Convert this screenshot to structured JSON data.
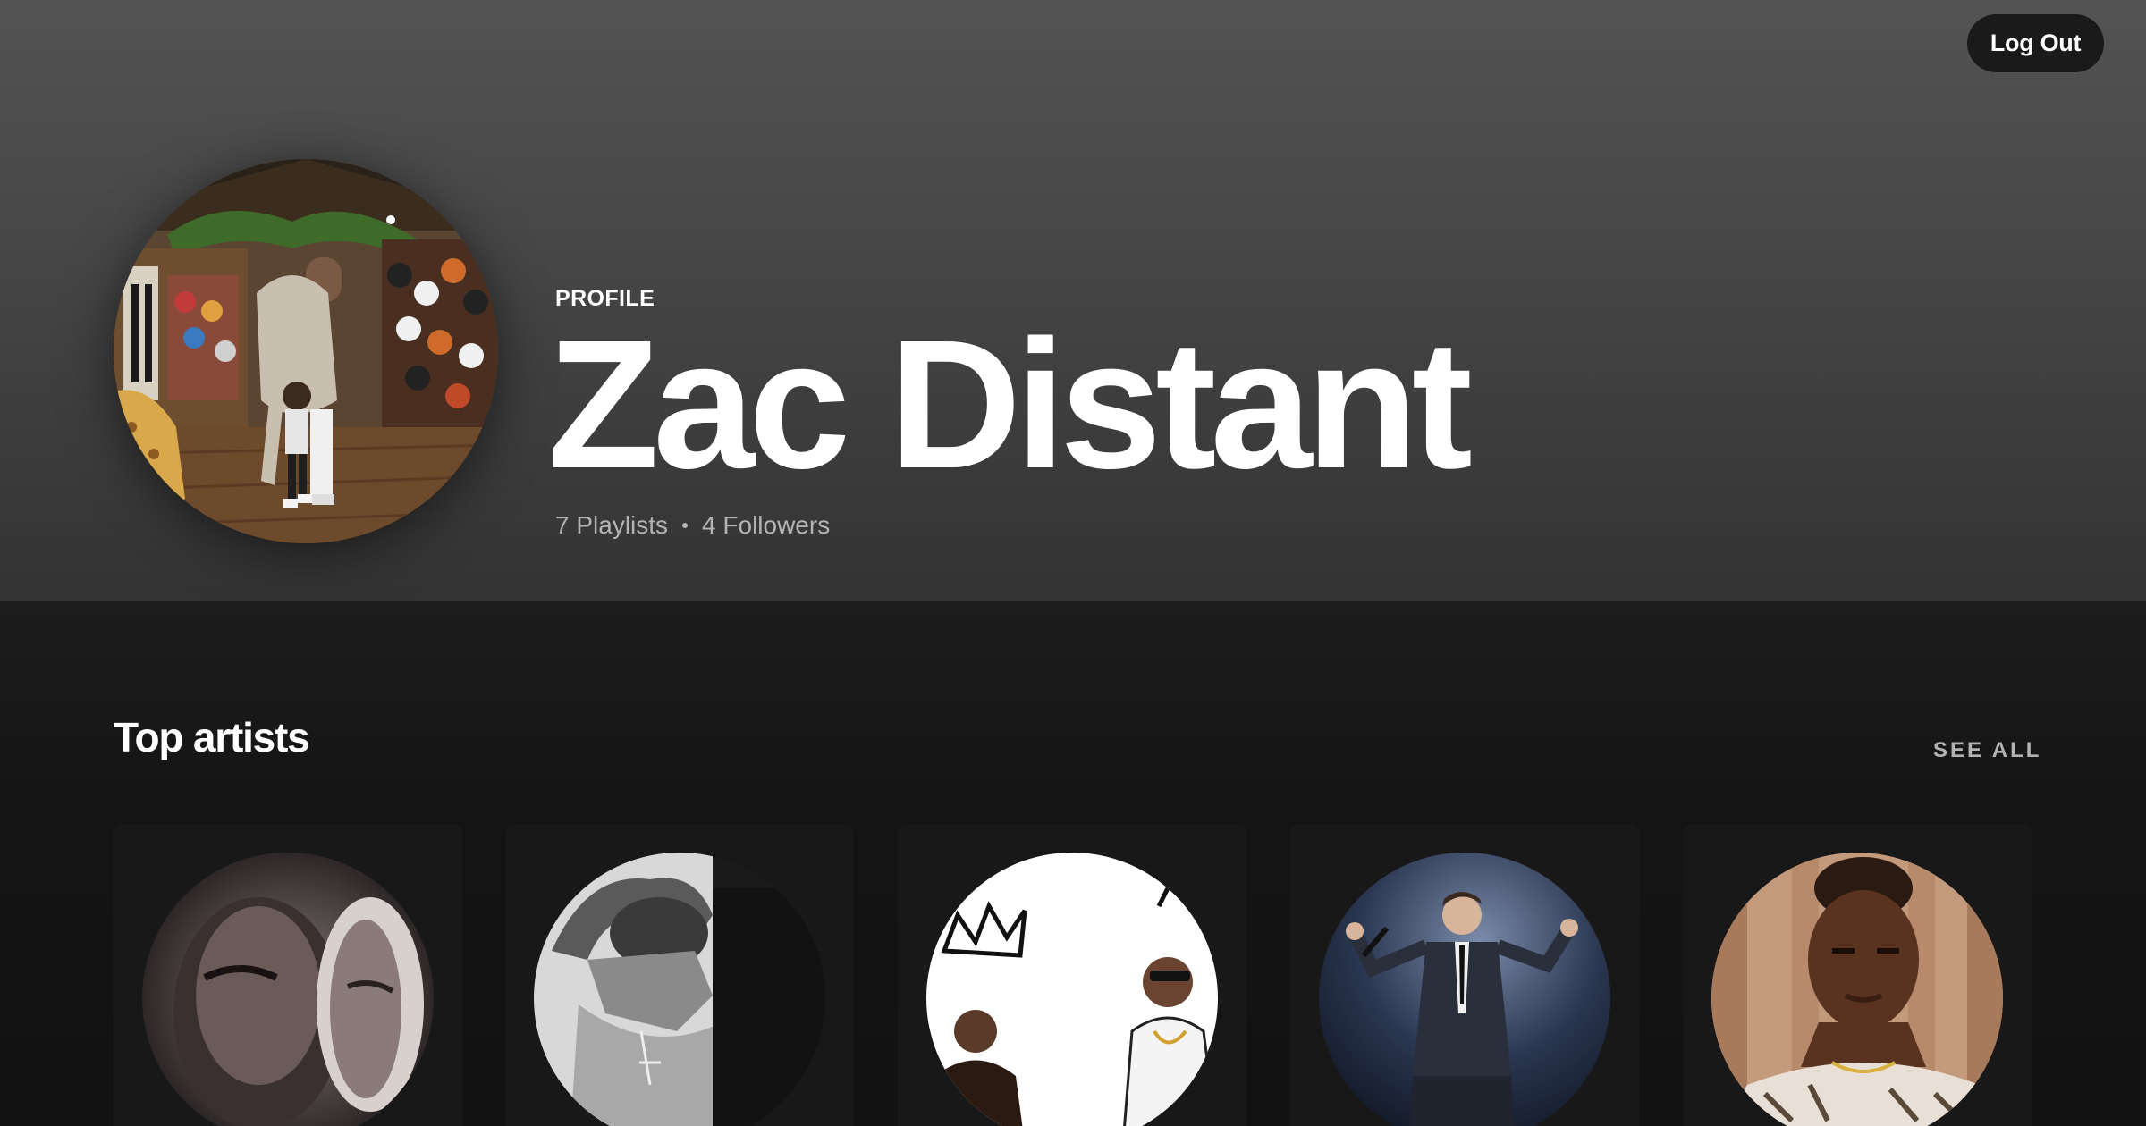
{
  "header": {
    "logout_label": "Log Out",
    "profile_label": "PROFILE",
    "name": "Zac Distant",
    "playlists": "7 Playlists",
    "followers": "4 Followers"
  },
  "top_artists": {
    "title": "Top artists",
    "see_all_label": "SEE ALL"
  },
  "colors": {
    "background": "#121212",
    "card": "#181818",
    "button": "#1a1a1a",
    "muted_text": "#b3b3b3"
  }
}
